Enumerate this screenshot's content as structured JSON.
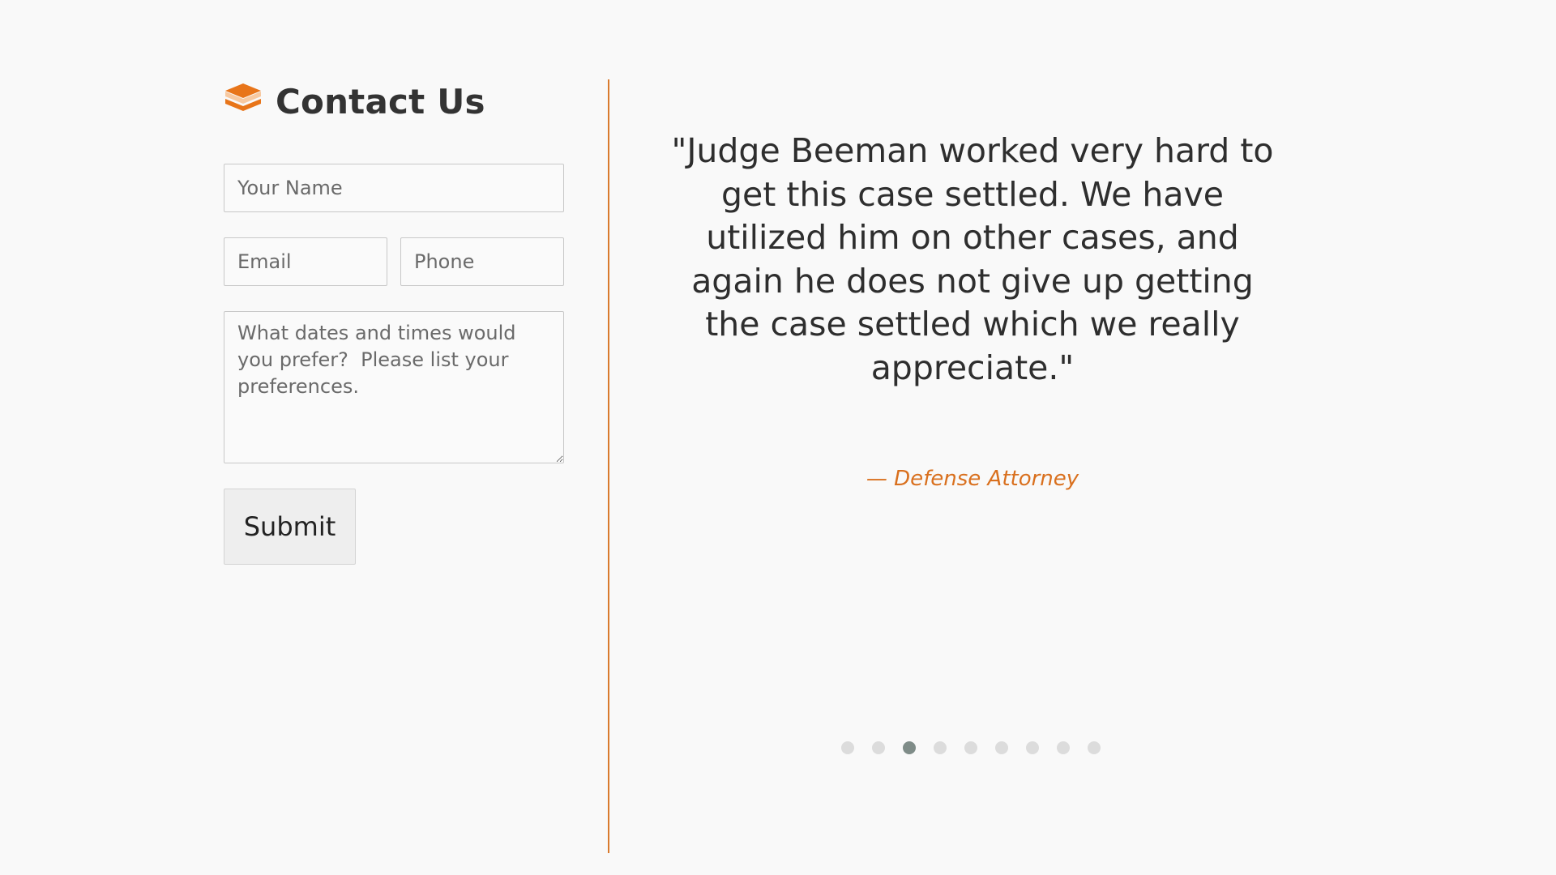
{
  "contact": {
    "title": "Contact Us",
    "logo_icon": "layers-stack-icon",
    "accent_color": "#e8751a",
    "name_placeholder": "Your Name",
    "email_placeholder": "Email",
    "phone_placeholder": "Phone",
    "message_placeholder": "What dates and times would you prefer?  Please list your preferences.",
    "submit_label": "Submit"
  },
  "testimonial": {
    "quote": "\"Judge Beeman worked very hard to get this case settled. We have utilized him on other cases, and again he does not give up getting the case settled which we really appreciate.\"",
    "author": "— Defense Attorney",
    "author_color": "#d9701e"
  },
  "carousel": {
    "total_slides": 9,
    "active_index": 2
  },
  "divider_color": "#d97b2e"
}
